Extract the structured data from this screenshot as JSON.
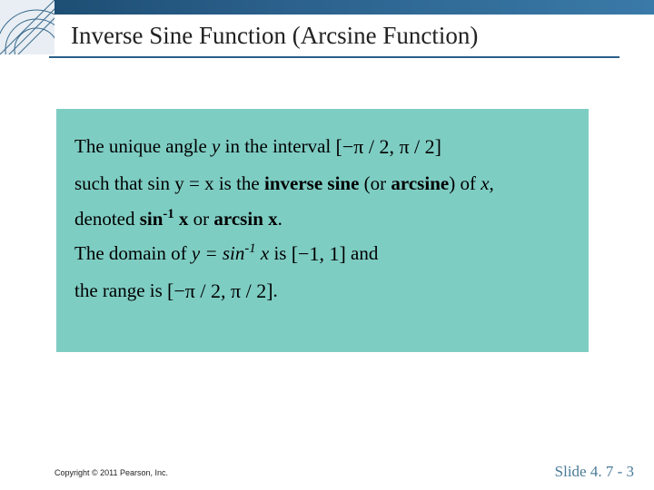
{
  "header": {
    "title": "Inverse Sine Function (Arcsine Function)"
  },
  "content": {
    "line1_a": "The unique angle ",
    "line1_y": "y",
    "line1_b": " in the interval ",
    "interval1": "[−π / 2, π / 2]",
    "line2_a": "such that ",
    "eq1": "sin y = x",
    "line2_b": " is the ",
    "bold_inv": "inverse sine",
    "line2_c": " (or ",
    "bold_arc": "arcsine",
    "line2_d": ") of ",
    "line2_x": "x",
    "line2_e": ",",
    "line3_a": "denoted ",
    "bold_sin": "sin",
    "bold_sup": "-1",
    "bold_x1": " x",
    "line3_b": " or ",
    "bold_arcsin": "arcsin x",
    "line3_c": ".",
    "line4_a": "The domain of ",
    "eq2_a": "y = sin",
    "eq2_sup": "-1",
    "eq2_b": " x",
    "line4_b": " is ",
    "interval2": "[−1, 1]",
    "line4_c": " and",
    "line5_a": "the range is ",
    "interval3": "[−π / 2, π / 2]",
    "line5_b": "."
  },
  "footer": {
    "copyright": "Copyright © 2011 Pearson, Inc.",
    "slide": "Slide 4. 7 - 3"
  }
}
